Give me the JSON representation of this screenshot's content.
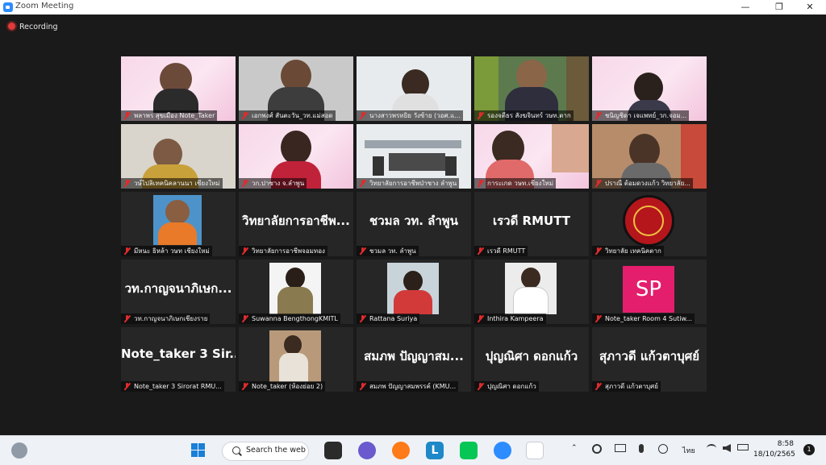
{
  "window": {
    "title": "Zoom Meeting",
    "minimize": "—",
    "maximize": "❐",
    "close": "✕"
  },
  "recording": {
    "label": "Recording"
  },
  "tiles": [
    {
      "name": "พลาพร สุขเมือง Note_Taker",
      "type": "video"
    },
    {
      "name": "เอกพงศ์ สันตะวัน_วท.แม่สอด",
      "type": "video"
    },
    {
      "name": "นางสาวพรทยิย วังซ้าย (วอศ.แ...",
      "type": "video"
    },
    {
      "name": "รองจตีธร สังฆจินทร์ วษท.ตาก",
      "type": "video"
    },
    {
      "name": "ชนิญชิดา เจแพทย์_วก.จอม...",
      "type": "video"
    },
    {
      "name": "วษ์ไปลิเทคนิคลานนา เชียงใหม่",
      "type": "video"
    },
    {
      "name": "วก.ปาซาง จ.ลำพูน",
      "type": "video"
    },
    {
      "name": "วิทยาลัยการอาชีพป่าซาง ลำพูน",
      "type": "video"
    },
    {
      "name": "การะเกด วษท.เชียงใหม่",
      "type": "video"
    },
    {
      "name": "ปราณี ต้อมดวงแก้ว วิทยาลัย...",
      "type": "video"
    },
    {
      "name": "มีหนะ ธิหล้า วษท เชียงใหม่",
      "type": "photo"
    },
    {
      "name": "วิทยาลัยการอาชีพจอมทอง",
      "type": "text",
      "big": "วิทยาลัยการอาชีพ..."
    },
    {
      "name": "ชวมล วท. ลำพูน",
      "type": "text",
      "big": "ชวมล วท. ลำพูน"
    },
    {
      "name": "เรวดี RMUTT",
      "type": "text",
      "big": "เรวดี RMUTT"
    },
    {
      "name": "วิทยาลัย เทคนิคตาก",
      "type": "logo"
    },
    {
      "name": "วท.กาญจนาภิเษกเชียงราย",
      "type": "text",
      "big": "วท.กาญจนาภิเษก..."
    },
    {
      "name": "Suwanna BengthongKMITL",
      "type": "photo"
    },
    {
      "name": "Rattana Suriya",
      "type": "photo"
    },
    {
      "name": "Inthira Kampeera",
      "type": "photo"
    },
    {
      "name": "Note_taker Room 4 Sutiw...",
      "type": "avatar",
      "initials": "SP"
    },
    {
      "name": "Note_taker 3 Sirorat RMU...",
      "type": "text",
      "big": "Note_taker 3 Sir..."
    },
    {
      "name": "Note_taker (ห้องย่อย 2)",
      "type": "photo"
    },
    {
      "name": "สมภพ ปัญญาสมพรรค์ (KMU...",
      "type": "text",
      "big": "สมภพ ปัญญาสม..."
    },
    {
      "name": "ปุญณิศา  ดอกแก้ว",
      "type": "text",
      "big": "ปุญณิศา  ดอกแก้ว"
    },
    {
      "name": "สุภาวดี แก้วตาบุศย์",
      "type": "text",
      "big": "สุภาวดี แก้วตาบุศย์"
    }
  ],
  "taskbar": {
    "search_label": "Search the web",
    "apps": [
      "start-icon",
      "search",
      "file-explorer-icon",
      "messenger-icon",
      "firefox-icon",
      "l-app-icon",
      "line-icon",
      "zoom-icon",
      "snipping-tool-icon"
    ],
    "tray": {
      "chevron": "⌃",
      "lang": "ไทย"
    },
    "time": "8:58",
    "date": "18/10/2565",
    "notifications": "1"
  },
  "colors": {
    "zoom_blue": "#2d8cff",
    "muted_red": "#e02b2b",
    "sp_avatar": "#e41e6d"
  }
}
